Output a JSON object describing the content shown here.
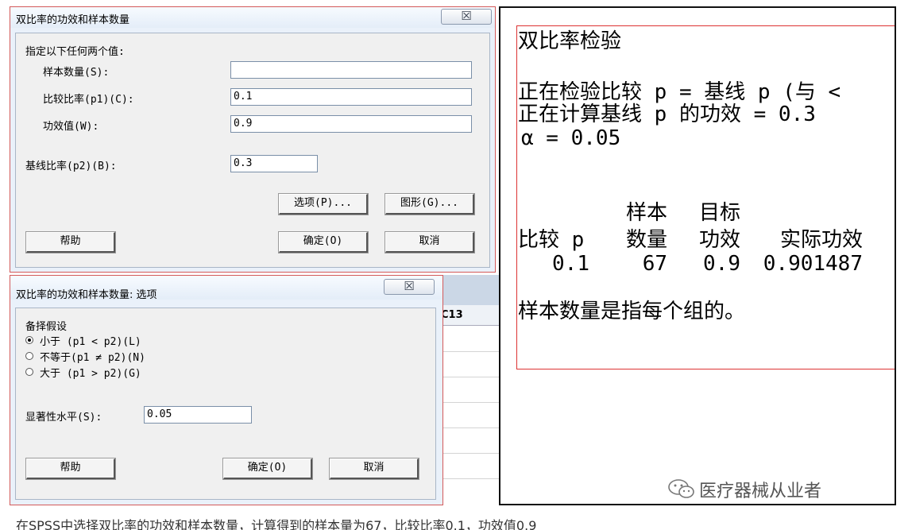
{
  "dialog1": {
    "title": "双比率的功效和样本数量",
    "close_glyph": "☒",
    "instruction": "指定以下任何两个值:",
    "sample_size_label": "样本数量(S):",
    "sample_size_value": "",
    "compare_label": "比较比率(p1)(C):",
    "compare_value": "0.1",
    "power_label": "功效值(W):",
    "power_value": "0.9",
    "baseline_label": "基线比率(p2)(B):",
    "baseline_value": "0.3",
    "options_button": "选项(P)...",
    "graph_button": "图形(G)...",
    "help_button": "帮助",
    "ok_button": "确定(O)",
    "cancel_button": "取消"
  },
  "dialog2": {
    "title": "双比率的功效和样本数量: 选项",
    "close_glyph": "☒",
    "alt_group_label": "备择假设",
    "options": [
      {
        "label": "小于 (p1 < p2)(L)",
        "selected": true
      },
      {
        "label": "不等于(p1 ≠ p2)(N)",
        "selected": false
      },
      {
        "label": "大于 (p1 > p2)(G)",
        "selected": false
      }
    ],
    "significance_label": "显著性水平(S):",
    "significance_value": "0.05",
    "help_button": "帮助",
    "ok_button": "确定(O)",
    "cancel_button": "取消"
  },
  "sheet": {
    "column_header": "C13"
  },
  "output": {
    "heading": "双比率检验",
    "line1": "正在检验比较 p = 基线 p (与 <",
    "line2": "正在计算基线 p 的功效 = 0.3",
    "line3": "α = 0.05",
    "table": {
      "head_top": [
        "",
        "样本",
        "目标",
        ""
      ],
      "head_bottom": [
        "比较 p",
        "数量",
        "功效",
        "实际功效"
      ],
      "row": [
        "0.1",
        "67",
        "0.9",
        "0.901487"
      ]
    },
    "note": "样本数量是指每个组的。"
  },
  "watermark": "医疗器械从业者",
  "caption": "在SPSS中选择双比率的功效和样本数量，计算得到的样本量为67，比较比率0.1，功效值0.9"
}
